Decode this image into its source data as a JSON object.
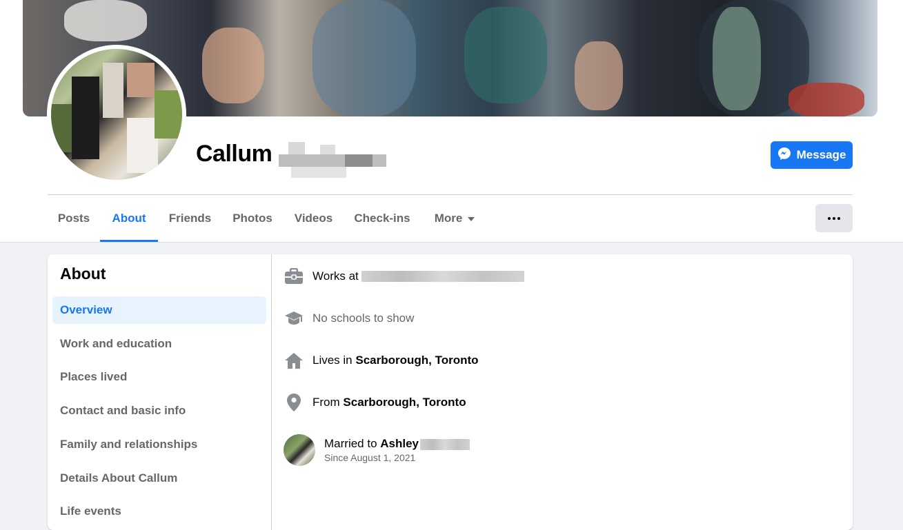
{
  "profile": {
    "first_name": "Callum",
    "message_label": "Message"
  },
  "tabs": [
    {
      "label": "Posts"
    },
    {
      "label": "About",
      "active": true
    },
    {
      "label": "Friends"
    },
    {
      "label": "Photos"
    },
    {
      "label": "Videos"
    },
    {
      "label": "Check-ins"
    },
    {
      "label": "More"
    }
  ],
  "about": {
    "title": "About",
    "nav": [
      {
        "label": "Overview",
        "active": true
      },
      {
        "label": "Work and education"
      },
      {
        "label": "Places lived"
      },
      {
        "label": "Contact and basic info"
      },
      {
        "label": "Family and relationships"
      },
      {
        "label": "Details About Callum"
      },
      {
        "label": "Life events"
      }
    ],
    "overview": {
      "work_prefix": "Works at",
      "schools": "No schools to show",
      "lives_prefix": "Lives in",
      "lives_place": "Scarborough, Toronto",
      "from_prefix": "From",
      "from_place": "Scarborough, Toronto",
      "married_prefix": "Married to",
      "spouse_first_name": "Ashley",
      "married_since": "Since August 1, 2021"
    }
  },
  "icons": {
    "work": "briefcase-icon",
    "school": "graduation-cap-icon",
    "lives": "home-icon",
    "from": "location-pin-icon",
    "message": "messenger-icon",
    "more": "ellipsis-icon"
  },
  "colors": {
    "accent": "#1877f2",
    "page_bg": "#f0f2f5",
    "muted_text": "#65676b",
    "icon_gray": "#8a8d91"
  }
}
